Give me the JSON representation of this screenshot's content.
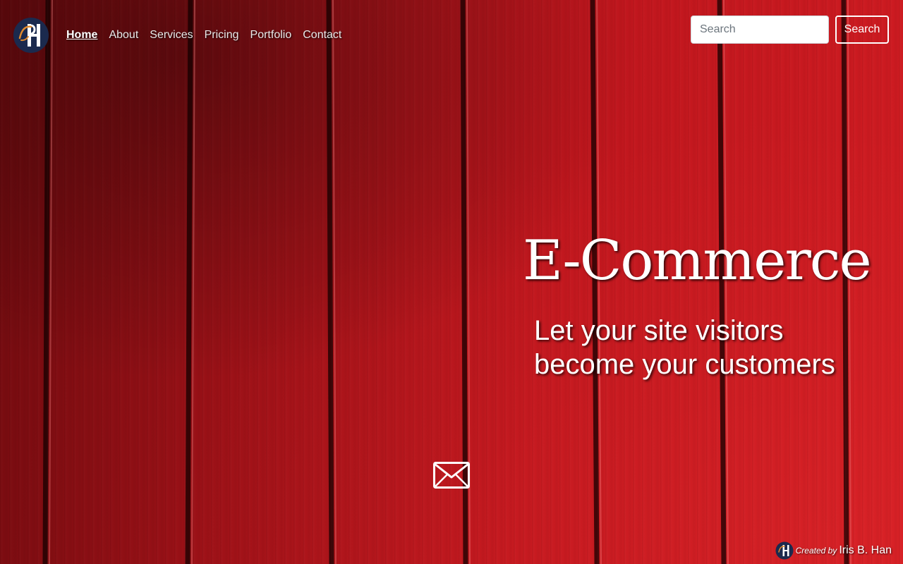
{
  "nav": {
    "logo_icon": "brand-monogram-logo",
    "links": [
      {
        "label": "Home",
        "active": true
      },
      {
        "label": "About",
        "active": false
      },
      {
        "label": "Services",
        "active": false
      },
      {
        "label": "Pricing",
        "active": false
      },
      {
        "label": "Portfolio",
        "active": false
      },
      {
        "label": "Contact",
        "active": false
      }
    ],
    "search": {
      "placeholder": "Search",
      "value": "",
      "button_label": "Search"
    }
  },
  "hero": {
    "title": "E-Commerce",
    "subtitle": "Let your site visitors become your customers",
    "background": "red painted wood planks",
    "contact_icon": "envelope-icon"
  },
  "footer": {
    "credit_prefix": "Created by",
    "credit_name": "Iris B. Han",
    "credit_logo_icon": "brand-monogram-logo"
  },
  "colors": {
    "background_red": "#c0161d",
    "background_dark_red": "#6d0a0e",
    "logo_navy": "#1b2a4e",
    "logo_orange": "#e08a2e",
    "text": "#ffffff"
  }
}
